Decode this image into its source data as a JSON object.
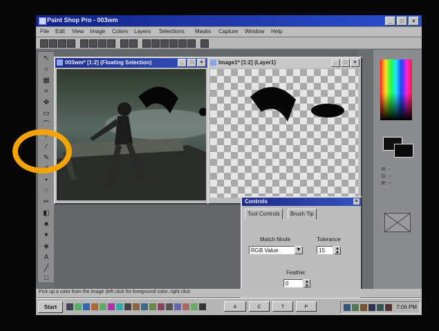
{
  "app": {
    "title": "Paint Shop Pro - 003wm"
  },
  "window_buttons": {
    "minimize": "_",
    "maximize": "□",
    "close": "×"
  },
  "menu": [
    "File",
    "Edit",
    "View",
    "Image",
    "Colors",
    "Layers",
    "Selections",
    "Masks",
    "Capture",
    "Window",
    "Help"
  ],
  "doc1": {
    "title": "003wm* [1:2] (Floating Selection)"
  },
  "doc2": {
    "title": "Image1* [1:2] (Layer1)"
  },
  "controls": {
    "title": "Controls",
    "close": "×",
    "tabs": [
      "Tool Controls",
      "Brush Tip"
    ],
    "match_mode_label": "Match Mode",
    "match_mode_value": "RGB Value",
    "tolerance_label": "Tolerance",
    "tolerance_value": "15",
    "feather_label": "Feather",
    "feather_value": "0"
  },
  "color_panel": {
    "r": "R: --",
    "g": "G: --",
    "b": "B: --"
  },
  "status_text": "Pick up a color from the image (left click for foreground color, right click",
  "taskbar": {
    "start": "Start",
    "tasks": [
      "A",
      "C",
      "T",
      "P"
    ],
    "clock": "7:06 PM"
  },
  "colors": {
    "title_active": "#1d2b8e",
    "annotation": "#f4a300"
  }
}
